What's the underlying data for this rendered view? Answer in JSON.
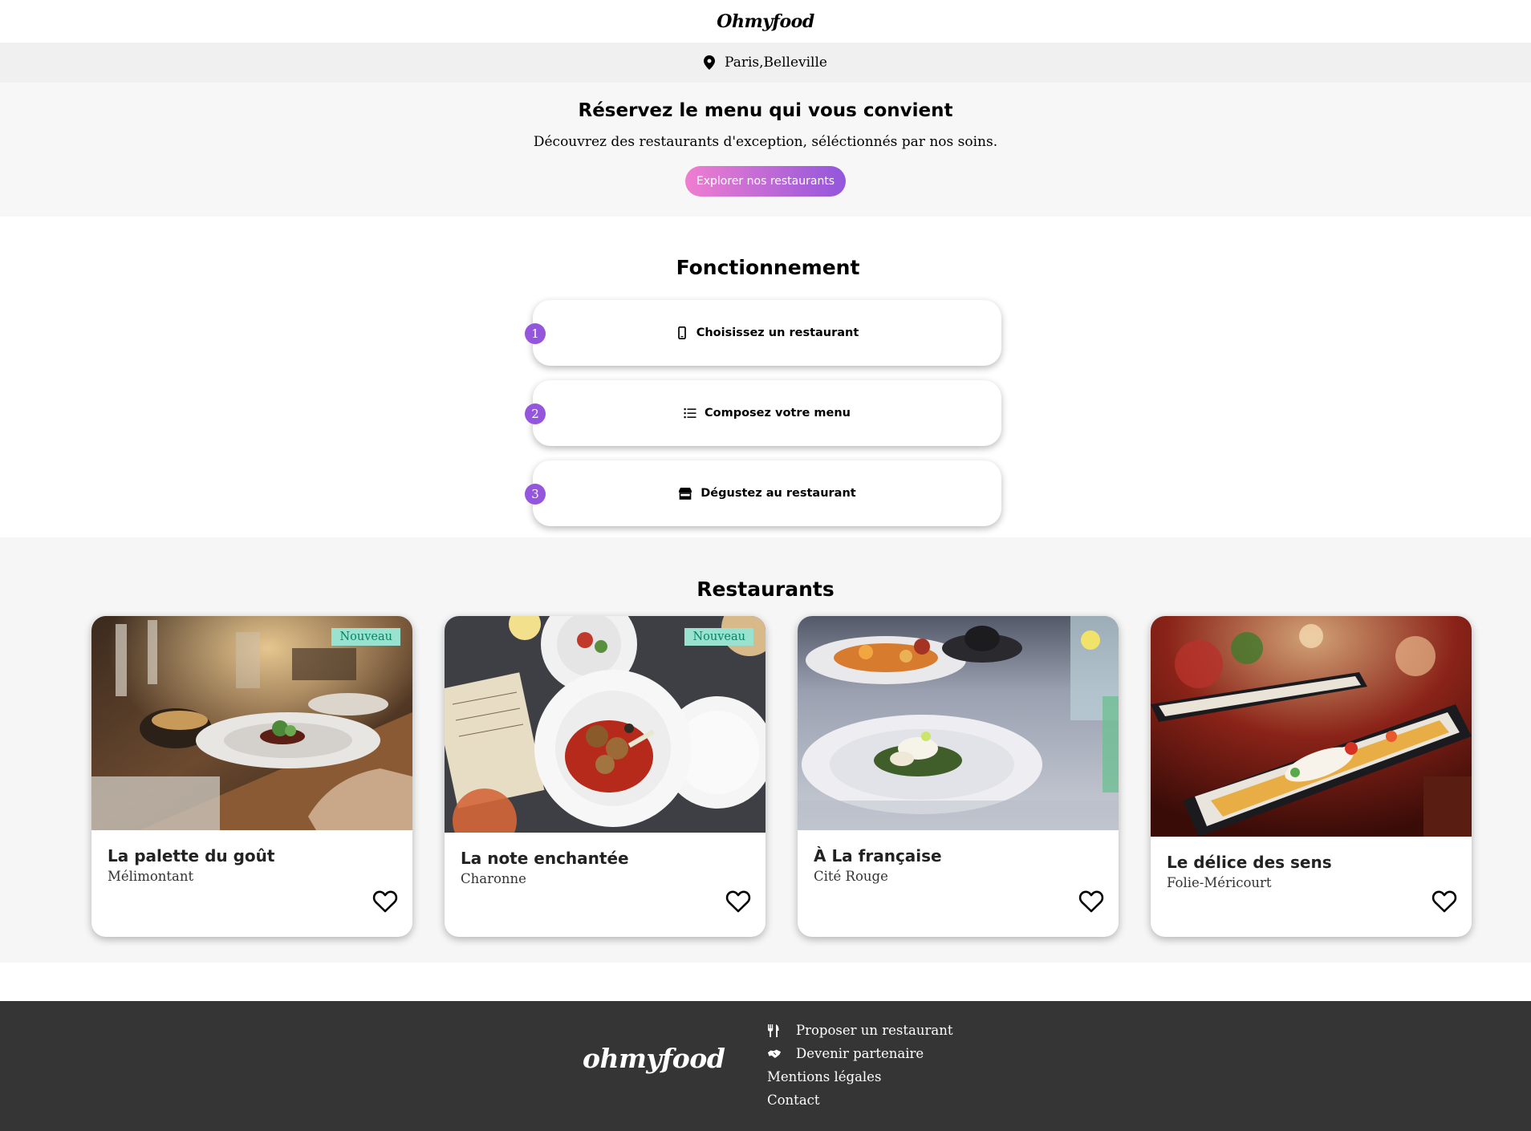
{
  "header": {
    "logo": "Ohmyfood"
  },
  "location": {
    "icon": "map-pin-icon",
    "text": "Paris,Belleville"
  },
  "hero": {
    "title": "Réservez le menu qui vous convient",
    "subtitle": "Découvrez des restaurants d'exception, séléctionnés par nos soins.",
    "button": "Explorer nos restaurants"
  },
  "howto": {
    "title": "Fonctionnement",
    "steps": [
      {
        "number": "1",
        "icon": "mobile-phone-icon",
        "label": "Choisissez un restaurant"
      },
      {
        "number": "2",
        "icon": "list-icon",
        "label": "Composez votre menu"
      },
      {
        "number": "3",
        "icon": "store-icon",
        "label": "Dégustez au restaurant"
      }
    ]
  },
  "restaurants": {
    "title": "Restaurants",
    "items": [
      {
        "name": "La palette du goût",
        "area": "Mélimontant",
        "badge": "Nouveau"
      },
      {
        "name": "La note enchantée",
        "area": "Charonne",
        "badge": "Nouveau"
      },
      {
        "name": "À La française",
        "area": "Cité Rouge",
        "badge": ""
      },
      {
        "name": "Le délice des sens",
        "area": "Folie-Méricourt",
        "badge": ""
      }
    ]
  },
  "footer": {
    "logo": "ohmyfood",
    "links": [
      {
        "icon": "utensils-icon",
        "label": "Proposer un restaurant"
      },
      {
        "icon": "handshake-icon",
        "label": "Devenir partenaire"
      },
      {
        "icon": "",
        "label": "Mentions légales"
      },
      {
        "icon": "",
        "label": "Contact"
      }
    ]
  },
  "colors": {
    "accent_purple": "#9356dc",
    "accent_pink": "#ef7ed0",
    "badge_bg": "#99e2d0",
    "badge_text": "#008766",
    "footer_bg": "#353535"
  }
}
